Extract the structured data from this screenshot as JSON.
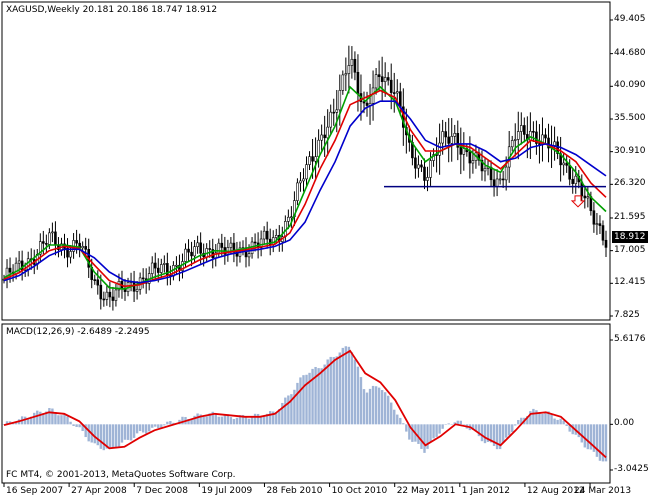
{
  "window": {
    "symbol_line": "XAGUSD,Weekly  20.181 20.186 18.747 18.912",
    "macd_line": "MACD(12,26,9) -2.6489 -2.2495",
    "copyright": "FC MT4, © 2001-2013, MetaQuotes Software Corp.",
    "current_price": "18.912"
  },
  "colors": {
    "background": "#ffffff",
    "candles": "#000000",
    "ma_fast": "#00a000",
    "ma_mid": "#e00000",
    "ma_slow": "#0000cc",
    "support_line": "#000080",
    "arrow": "#e00000",
    "histogram": "#9fb4d6",
    "signal": "#e00000"
  },
  "icons": {
    "sell_arrow": "down-arrow-icon"
  },
  "chart_data": [
    {
      "type": "line",
      "title": "XAGUSD,Weekly",
      "x": [
        "16 Sep 2007",
        "27 Apr 2008",
        "7 Dec 2008",
        "19 Jul 2009",
        "28 Feb 2010",
        "10 Oct 2010",
        "22 May 2011",
        "1 Jan 2012",
        "12 Aug 2012",
        "24 Mar 2013"
      ],
      "y_ticks": [
        "49.405",
        "44.680",
        "40.090",
        "35.500",
        "30.910",
        "26.320",
        "21.595",
        "17.005",
        "12.415",
        "7.825"
      ],
      "ylim": [
        7.825,
        49.405
      ],
      "series": [
        {
          "name": "",
          "role": "price-close",
          "values": [
            13.0,
            14.5,
            16.5,
            18.5,
            17.5,
            18.0,
            12.5,
            10.5,
            11.5,
            13.0,
            14.0,
            14.5,
            16.0,
            17.0,
            17.5,
            16.5,
            17.5,
            18.0,
            18.5,
            22.0,
            28.0,
            33.0,
            36.0,
            45.0,
            36.0,
            42.0,
            40.0,
            30.0,
            28.0,
            32.0,
            33.0,
            30.0,
            28.0,
            27.0,
            33.0,
            34.0,
            32.0,
            30.0,
            27.0,
            22.0,
            18.9
          ]
        },
        {
          "name": "",
          "role": "ma-fast",
          "values": [
            13.2,
            14.3,
            16.0,
            17.8,
            17.8,
            17.5,
            14.0,
            11.8,
            11.6,
            12.4,
            13.3,
            14.0,
            15.2,
            16.3,
            17.0,
            16.9,
            17.3,
            17.8,
            18.2,
            20.5,
            25.5,
            30.5,
            34.5,
            40.0,
            38.0,
            40.0,
            38.0,
            32.5,
            29.5,
            31.0,
            32.0,
            31.0,
            29.0,
            28.0,
            31.5,
            33.0,
            32.0,
            30.5,
            28.0,
            24.5,
            22.5
          ]
        },
        {
          "name": "",
          "role": "ma-mid",
          "values": [
            13.0,
            13.9,
            15.4,
            17.0,
            17.6,
            17.3,
            15.0,
            12.8,
            12.0,
            12.2,
            13.0,
            13.6,
            14.6,
            15.7,
            16.5,
            16.8,
            17.1,
            17.5,
            17.9,
            19.5,
            23.5,
            28.5,
            32.5,
            37.5,
            38.5,
            39.5,
            38.5,
            34.0,
            31.0,
            31.0,
            32.0,
            31.5,
            30.0,
            28.5,
            30.5,
            32.5,
            32.0,
            31.0,
            29.5,
            26.5,
            24.5
          ]
        },
        {
          "name": "",
          "role": "ma-slow",
          "values": [
            12.8,
            13.5,
            14.8,
            16.3,
            17.2,
            17.2,
            16.0,
            14.0,
            12.8,
            12.5,
            12.8,
            13.3,
            14.1,
            15.0,
            15.9,
            16.5,
            16.9,
            17.2,
            17.6,
            18.5,
            21.0,
            25.5,
            29.5,
            34.5,
            37.0,
            38.0,
            38.0,
            35.5,
            32.5,
            31.5,
            32.0,
            32.0,
            31.0,
            29.5,
            30.0,
            31.5,
            32.0,
            31.5,
            30.5,
            29.0,
            27.5
          ]
        }
      ],
      "annotations": [
        {
          "type": "horizontal-line",
          "value": 26.0,
          "from_x": "22 May 2011",
          "to_x": "end"
        },
        {
          "type": "down-arrow",
          "x": "24 Mar 2013",
          "y": 24.0
        }
      ]
    },
    {
      "type": "bar",
      "title": "MACD(12,26,9)",
      "y_ticks": [
        "5.6176",
        "0.00",
        "-3.0425"
      ],
      "ylim": [
        -3.0425,
        5.6176
      ],
      "series": [
        {
          "name": "",
          "role": "histogram",
          "values": [
            0.0,
            0.3,
            0.7,
            1.0,
            0.6,
            -0.3,
            -1.4,
            -1.7,
            -1.2,
            -0.6,
            -0.3,
            0.1,
            0.4,
            0.6,
            0.7,
            0.5,
            0.5,
            0.6,
            0.8,
            2.0,
            3.4,
            3.8,
            4.6,
            5.3,
            2.2,
            2.6,
            1.0,
            -1.0,
            -1.8,
            -0.4,
            0.3,
            -0.3,
            -1.2,
            -1.6,
            0.0,
            0.9,
            0.8,
            0.3,
            -0.8,
            -1.8,
            -2.6
          ]
        },
        {
          "name": "",
          "role": "signal",
          "values": [
            -0.05,
            0.2,
            0.5,
            0.8,
            0.7,
            0.2,
            -0.8,
            -1.6,
            -1.5,
            -0.9,
            -0.4,
            -0.1,
            0.2,
            0.5,
            0.7,
            0.6,
            0.5,
            0.5,
            0.7,
            1.5,
            2.6,
            3.4,
            4.3,
            4.9,
            3.4,
            2.8,
            1.6,
            -0.2,
            -1.4,
            -0.8,
            0.0,
            -0.2,
            -0.9,
            -1.4,
            -0.4,
            0.7,
            0.8,
            0.5,
            -0.4,
            -1.3,
            -2.2
          ]
        }
      ]
    }
  ]
}
